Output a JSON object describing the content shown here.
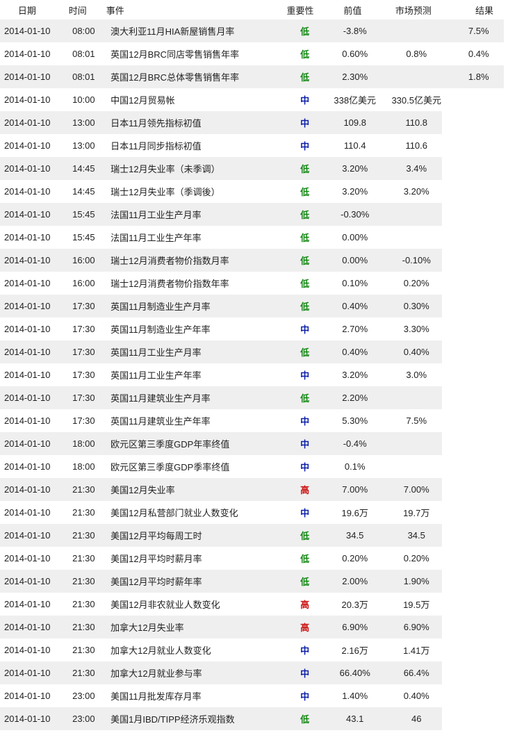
{
  "header": {
    "date": "日期",
    "time": "时间",
    "event": "事件",
    "importance": "重要性",
    "previous": "前值",
    "forecast": "市场预测",
    "result": "结果"
  },
  "importance_colors": {
    "低": "#118811",
    "中": "#0a1fa8",
    "高": "#cc1111"
  },
  "rows": [
    {
      "date": "2014-01-10",
      "time": "08:00",
      "event": "澳大利亚11月HIA新屋销售月率",
      "importance": "低",
      "previous": "-3.8%",
      "forecast": "",
      "result": "7.5%"
    },
    {
      "date": "2014-01-10",
      "time": "08:01",
      "event": "英国12月BRC同店零售销售年率",
      "importance": "低",
      "previous": "0.60%",
      "forecast": "0.8%",
      "result": "0.4%"
    },
    {
      "date": "2014-01-10",
      "time": "08:01",
      "event": "英国12月BRC总体零售销售年率",
      "importance": "低",
      "previous": "2.30%",
      "forecast": "",
      "result": "1.8%"
    },
    {
      "date": "2014-01-10",
      "time": "10:00",
      "event": "中国12月贸易帐",
      "importance": "中",
      "previous": "338亿美元",
      "forecast": "330.5亿美元",
      "result": ""
    },
    {
      "date": "2014-01-10",
      "time": "13:00",
      "event": "日本11月领先指标初值",
      "importance": "中",
      "previous": "109.8",
      "forecast": "110.8",
      "result": ""
    },
    {
      "date": "2014-01-10",
      "time": "13:00",
      "event": "日本11月同步指标初值",
      "importance": "中",
      "previous": "110.4",
      "forecast": "110.6",
      "result": ""
    },
    {
      "date": "2014-01-10",
      "time": "14:45",
      "event": "瑞士12月失业率（未季调）",
      "importance": "低",
      "previous": "3.20%",
      "forecast": "3.4%",
      "result": ""
    },
    {
      "date": "2014-01-10",
      "time": "14:45",
      "event": "瑞士12月失业率（季调後）",
      "importance": "低",
      "previous": "3.20%",
      "forecast": "3.20%",
      "result": ""
    },
    {
      "date": "2014-01-10",
      "time": "15:45",
      "event": "法国11月工业生产月率",
      "importance": "低",
      "previous": "-0.30%",
      "forecast": "",
      "result": ""
    },
    {
      "date": "2014-01-10",
      "time": "15:45",
      "event": "法国11月工业生产年率",
      "importance": "低",
      "previous": "0.00%",
      "forecast": "",
      "result": ""
    },
    {
      "date": "2014-01-10",
      "time": "16:00",
      "event": "瑞士12月消费者物价指数月率",
      "importance": "低",
      "previous": "0.00%",
      "forecast": "-0.10%",
      "result": ""
    },
    {
      "date": "2014-01-10",
      "time": "16:00",
      "event": "瑞士12月消费者物价指数年率",
      "importance": "低",
      "previous": "0.10%",
      "forecast": "0.20%",
      "result": ""
    },
    {
      "date": "2014-01-10",
      "time": "17:30",
      "event": "英国11月制造业生产月率",
      "importance": "低",
      "previous": "0.40%",
      "forecast": "0.30%",
      "result": ""
    },
    {
      "date": "2014-01-10",
      "time": "17:30",
      "event": "英国11月制造业生产年率",
      "importance": "中",
      "previous": "2.70%",
      "forecast": "3.30%",
      "result": ""
    },
    {
      "date": "2014-01-10",
      "time": "17:30",
      "event": "英国11月工业生产月率",
      "importance": "低",
      "previous": "0.40%",
      "forecast": "0.40%",
      "result": ""
    },
    {
      "date": "2014-01-10",
      "time": "17:30",
      "event": "英国11月工业生产年率",
      "importance": "中",
      "previous": "3.20%",
      "forecast": "3.0%",
      "result": ""
    },
    {
      "date": "2014-01-10",
      "time": "17:30",
      "event": "英国11月建筑业生产月率",
      "importance": "低",
      "previous": "2.20%",
      "forecast": "",
      "result": ""
    },
    {
      "date": "2014-01-10",
      "time": "17:30",
      "event": "英国11月建筑业生产年率",
      "importance": "中",
      "previous": "5.30%",
      "forecast": "7.5%",
      "result": ""
    },
    {
      "date": "2014-01-10",
      "time": "18:00",
      "event": "欧元区第三季度GDP年率终值",
      "importance": "中",
      "previous": "-0.4%",
      "forecast": "",
      "result": ""
    },
    {
      "date": "2014-01-10",
      "time": "18:00",
      "event": "欧元区第三季度GDP季率终值",
      "importance": "中",
      "previous": "0.1%",
      "forecast": "",
      "result": ""
    },
    {
      "date": "2014-01-10",
      "time": "21:30",
      "event": "美国12月失业率",
      "importance": "高",
      "previous": "7.00%",
      "forecast": "7.00%",
      "result": ""
    },
    {
      "date": "2014-01-10",
      "time": "21:30",
      "event": "美国12月私营部门就业人数变化",
      "importance": "中",
      "previous": "19.6万",
      "forecast": "19.7万",
      "result": ""
    },
    {
      "date": "2014-01-10",
      "time": "21:30",
      "event": "美国12月平均每周工时",
      "importance": "低",
      "previous": "34.5",
      "forecast": "34.5",
      "result": ""
    },
    {
      "date": "2014-01-10",
      "time": "21:30",
      "event": "美国12月平均时薪月率",
      "importance": "低",
      "previous": "0.20%",
      "forecast": "0.20%",
      "result": ""
    },
    {
      "date": "2014-01-10",
      "time": "21:30",
      "event": "美国12月平均时薪年率",
      "importance": "低",
      "previous": "2.00%",
      "forecast": "1.90%",
      "result": ""
    },
    {
      "date": "2014-01-10",
      "time": "21:30",
      "event": "美国12月非农就业人数变化",
      "importance": "高",
      "previous": "20.3万",
      "forecast": "19.5万",
      "result": ""
    },
    {
      "date": "2014-01-10",
      "time": "21:30",
      "event": "加拿大12月失业率",
      "importance": "高",
      "previous": "6.90%",
      "forecast": "6.90%",
      "result": ""
    },
    {
      "date": "2014-01-10",
      "time": "21:30",
      "event": "加拿大12月就业人数变化",
      "importance": "中",
      "previous": "2.16万",
      "forecast": "1.41万",
      "result": ""
    },
    {
      "date": "2014-01-10",
      "time": "21:30",
      "event": "加拿大12月就业参与率",
      "importance": "中",
      "previous": "66.40%",
      "forecast": "66.4%",
      "result": ""
    },
    {
      "date": "2014-01-10",
      "time": "23:00",
      "event": "美国11月批发库存月率",
      "importance": "中",
      "previous": "1.40%",
      "forecast": "0.40%",
      "result": ""
    },
    {
      "date": "2014-01-10",
      "time": "23:00",
      "event": "美国1月IBD/TIPP经济乐观指数",
      "importance": "低",
      "previous": "43.1",
      "forecast": "46",
      "result": ""
    }
  ]
}
